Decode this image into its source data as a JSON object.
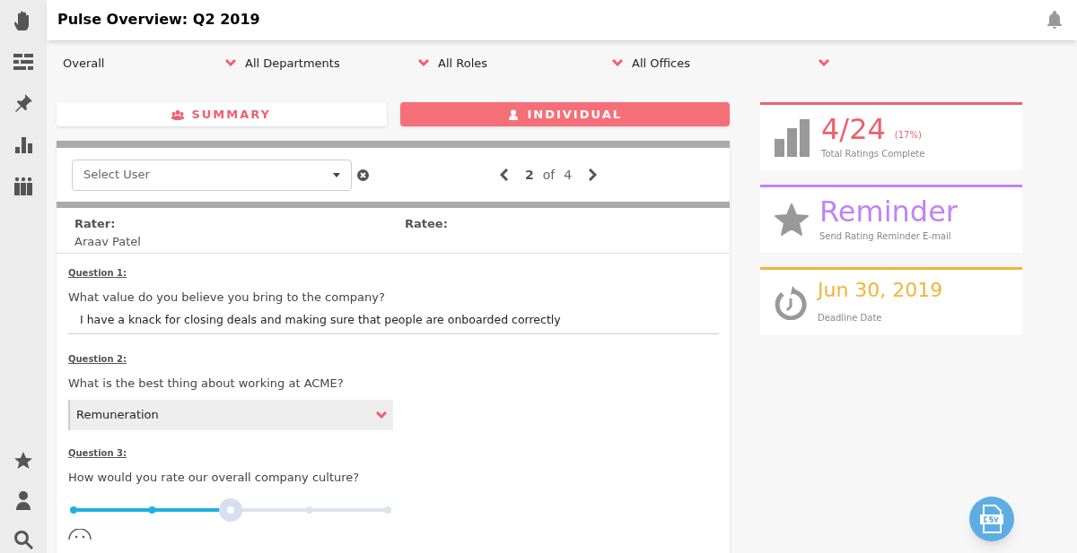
{
  "header": {
    "title": "Pulse Overview: Q2 2019"
  },
  "sidebar": {
    "top_items": [
      {
        "kind": "hand",
        "selected": false
      },
      {
        "kind": "layout",
        "selected": false
      },
      {
        "kind": "pin",
        "selected": false
      },
      {
        "kind": "chart",
        "selected": false
      },
      {
        "kind": "people",
        "selected": false
      }
    ],
    "bottom_items": [
      {
        "kind": "star",
        "selected": false
      },
      {
        "kind": "person",
        "selected": false
      },
      {
        "kind": "search",
        "selected": false
      }
    ]
  },
  "filters": [
    "Overall",
    "All Departments",
    "All Roles",
    "All Offices"
  ],
  "tabs": [
    {
      "label": "SUMMARY",
      "kind": "group",
      "selected": false
    },
    {
      "label": "INDIVIDUAL",
      "kind": "user",
      "selected": true
    }
  ],
  "user_select": {
    "placeholder": "Select User"
  },
  "pager": {
    "current": "2",
    "of": "of",
    "total": "4"
  },
  "rater": {
    "label": "Rater:",
    "value": "Araav Patel"
  },
  "ratee": {
    "label": "Ratee:"
  },
  "questions": [
    {
      "kind": "text",
      "label": "Question 1:",
      "question": "What value do you believe you bring to the company?",
      "answer": "I have a knack for closing deals and making sure that people are onboarded correctly"
    },
    {
      "kind": "choice",
      "label": "Question 2:",
      "question": "What is the best thing about working at ACME?",
      "answer": "Remuneration"
    },
    {
      "kind": "scale",
      "label": "Question 3:",
      "question": "How would you rate our overall company culture?",
      "level": 0.5
    }
  ],
  "stats": [
    {
      "kind": "chart",
      "color": "#f0606e",
      "value": "4/24",
      "extra": "(17%)",
      "caption": "Total Ratings Complete"
    },
    {
      "kind": "star",
      "color": "#c084f5",
      "value": "Reminder",
      "caption": "Send Rating Reminder E-mail"
    },
    {
      "kind": "timer",
      "color": "#f2b43a",
      "value": "Jun 30, 2019",
      "caption": "Deadline Date"
    }
  ]
}
